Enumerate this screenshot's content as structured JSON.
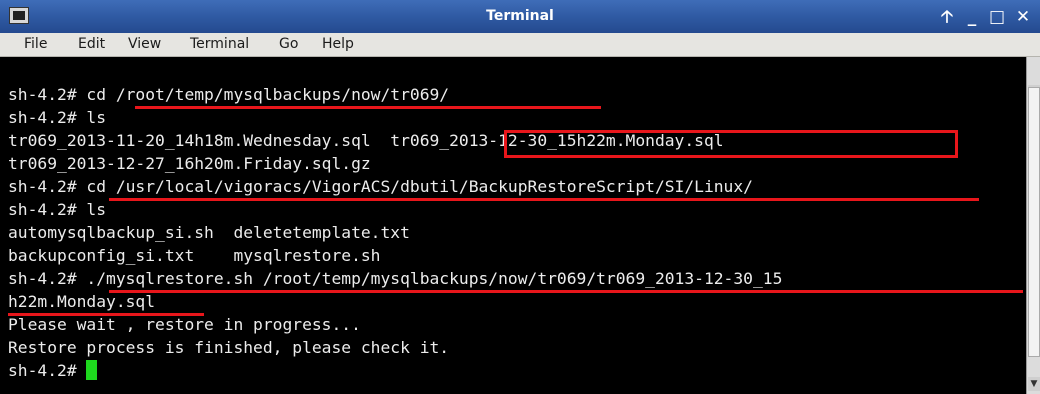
{
  "window": {
    "title": "Terminal",
    "controls": {
      "pin": "🡡",
      "minimize": "_",
      "maximize": "□",
      "close": "✕"
    }
  },
  "menu": {
    "file": "File",
    "edit": "Edit",
    "view": "View",
    "terminal": "Terminal",
    "go": "Go",
    "help": "Help"
  },
  "terminal": {
    "lines": [
      "sh-4.2# cd /root/temp/mysqlbackups/now/tr069/",
      "sh-4.2# ls",
      "tr069_2013-11-20_14h18m.Wednesday.sql  tr069_2013-12-30_15h22m.Monday.sql",
      "tr069_2013-12-27_16h20m.Friday.sql.gz",
      "sh-4.2# cd /usr/local/vigoracs/VigorACS/dbutil/BackupRestoreScript/SI/Linux/",
      "sh-4.2# ls",
      "automysqlbackup_si.sh  deletetemplate.txt",
      "backupconfig_si.txt    mysqlrestore.sh",
      "sh-4.2# ./mysqlrestore.sh /root/temp/mysqlbackups/now/tr069/tr069_2013-12-30_15",
      "h22m.Monday.sql",
      "Please wait , restore in progress...",
      "Restore process is finished, please check it.",
      "sh-4.2# "
    ]
  },
  "colors": {
    "highlight": "#e8161b",
    "cursor": "#1ed81e",
    "titlebar": "#2f5aa3"
  }
}
